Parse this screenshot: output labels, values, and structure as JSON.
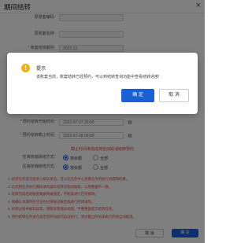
{
  "modal": {
    "title": "期间结转",
    "close_icon": "×"
  },
  "form": {
    "rows": [
      {
        "label": "原账套编码:",
        "value": "",
        "required": false
      },
      {
        "label": "原账套名称:",
        "value": "",
        "required": false
      },
      {
        "label": "账套结转期间:",
        "value": "2022.12",
        "required": true
      },
      {
        "label": "",
        "value": "",
        "required": false
      },
      {
        "label": "",
        "value": "",
        "required": false
      },
      {
        "label": "",
        "value": "",
        "required": false
      },
      {
        "label": "",
        "value": "",
        "required": false
      },
      {
        "label": "",
        "value": "",
        "required": false
      },
      {
        "label": "预约结转开始时间:",
        "value": "2022-07-27 20:00",
        "required": true
      },
      {
        "label": "预约结转截止时间:",
        "value": "2022-07-28 06:00",
        "required": true
      }
    ]
  },
  "notice_center": "截止时间未完成将自动取消结转预约",
  "radios": [
    {
      "label": "往来核销转结方式:",
      "opt1": "按余额",
      "opt2": "全部"
    },
    {
      "label": "往来核销转结方式:",
      "opt1": "按余额",
      "opt2": "全部"
    }
  ],
  "rules": [
    "1. 结转任务提交后进入排队状态，可以在任务中心查看任务的执行进度和结果。",
    "2. 在结转任务执行期间请勿操作结转涉及的账套，以免数据不一致。",
    "3. 结转完成后原账套数据将被锁定，不能再进行任何修改。",
    "4. 请确认本期所有凭证均已审核记账后再进行结转操作。",
    "5. 结转过程中如有异常，请联系管理员处理，不要重复提交结转任务。",
    "6. 预约结转任务会在指定的时间段内自动执行，到达截止时间未执行的将自动取消。"
  ],
  "footer": {
    "cancel_label": "取 消",
    "ok_label": "确 定"
  },
  "dialog": {
    "title": "提示",
    "icon": "!",
    "message": "该账套当前，账套结转已经预约，可以到结转查询功能中查看结转进度!",
    "ok_label": "确 定",
    "cancel_label": "取 消"
  },
  "colors": {
    "primary": "#1a5fd6",
    "warning": "#f5b301",
    "danger": "#e23b3b"
  }
}
